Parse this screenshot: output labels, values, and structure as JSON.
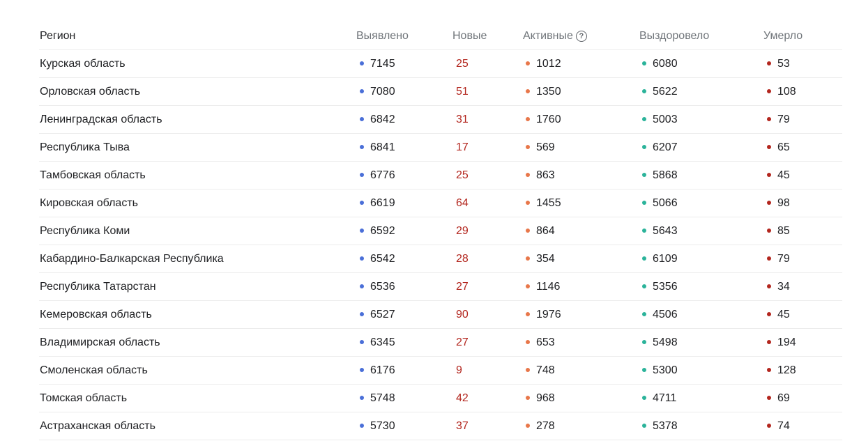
{
  "colors": {
    "detected_dot": "#4a6fd8",
    "active_dot": "#e8774a",
    "recovered_dot": "#2bb39a",
    "deaths_dot": "#b3261e",
    "new_text": "#b3261e"
  },
  "header": {
    "region": "Регион",
    "detected": "Выявлено",
    "new": "Новые",
    "active": "Активные",
    "active_help": "?",
    "recovered": "Выздоровело",
    "deaths": "Умерло"
  },
  "rows": [
    {
      "region": "Курская область",
      "detected": "7145",
      "new": "25",
      "active": "1012",
      "recovered": "6080",
      "deaths": "53"
    },
    {
      "region": "Орловская область",
      "detected": "7080",
      "new": "51",
      "active": "1350",
      "recovered": "5622",
      "deaths": "108"
    },
    {
      "region": "Ленинградская область",
      "detected": "6842",
      "new": "31",
      "active": "1760",
      "recovered": "5003",
      "deaths": "79"
    },
    {
      "region": "Республика Тыва",
      "detected": "6841",
      "new": "17",
      "active": "569",
      "recovered": "6207",
      "deaths": "65"
    },
    {
      "region": "Тамбовская область",
      "detected": "6776",
      "new": "25",
      "active": "863",
      "recovered": "5868",
      "deaths": "45"
    },
    {
      "region": "Кировская область",
      "detected": "6619",
      "new": "64",
      "active": "1455",
      "recovered": "5066",
      "deaths": "98"
    },
    {
      "region": "Республика Коми",
      "detected": "6592",
      "new": "29",
      "active": "864",
      "recovered": "5643",
      "deaths": "85"
    },
    {
      "region": "Кабардино-Балкарская Республика",
      "detected": "6542",
      "new": "28",
      "active": "354",
      "recovered": "6109",
      "deaths": "79"
    },
    {
      "region": "Республика Татарстан",
      "detected": "6536",
      "new": "27",
      "active": "1146",
      "recovered": "5356",
      "deaths": "34"
    },
    {
      "region": "Кемеровская область",
      "detected": "6527",
      "new": "90",
      "active": "1976",
      "recovered": "4506",
      "deaths": "45"
    },
    {
      "region": "Владимирская область",
      "detected": "6345",
      "new": "27",
      "active": "653",
      "recovered": "5498",
      "deaths": "194"
    },
    {
      "region": "Смоленская область",
      "detected": "6176",
      "new": "9",
      "active": "748",
      "recovered": "5300",
      "deaths": "128"
    },
    {
      "region": "Томская область",
      "detected": "5748",
      "new": "42",
      "active": "968",
      "recovered": "4711",
      "deaths": "69"
    },
    {
      "region": "Астраханская область",
      "detected": "5730",
      "new": "37",
      "active": "278",
      "recovered": "5378",
      "deaths": "74"
    }
  ]
}
